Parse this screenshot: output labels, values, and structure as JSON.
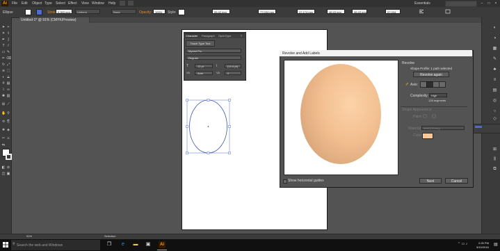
{
  "menubar": {
    "logo": "Ai",
    "items": [
      "File",
      "Edit",
      "Object",
      "Type",
      "Select",
      "Effect",
      "View",
      "Window",
      "Help"
    ],
    "workspace": "Essentials"
  },
  "controlbar": {
    "object_label": "Ellipse",
    "stroke_label": "Stroke:",
    "stroke_value": "0.353 mm",
    "uniform": "Uniform",
    "basic": "Basic",
    "opacity_label": "Opacity:",
    "opacity_value": "100%",
    "style_label": "Style:",
    "x_value": "55.42 mm",
    "y_value": "77.034 mm",
    "w_value": "37.174 mm",
    "h_value": "46.43 mm",
    "w2_value": "96.43 mm",
    "h2_value": "57.034 mm"
  },
  "document": {
    "tab_label": "Untitled-1* @ 91% (CMYK/Preview)",
    "zoom": "91%",
    "tool_status": "Selection"
  },
  "character_panel": {
    "tabs": [
      "Character",
      "Paragraph",
      "OpenType"
    ],
    "touch_type": "Touch Type Tool",
    "font": "Myriad Pro",
    "style": "Regular",
    "size": "12 pt",
    "leading": "(14.4 pt)",
    "kerning": "Auto",
    "tracking": "0"
  },
  "dialog": {
    "title": "Revolve and Add Labels",
    "section_title": "Revolve",
    "profile_status": "Shape Profile: 1 path selected",
    "revolve_again": "Revolve again",
    "axis_label": "Axis:",
    "complexity_label": "Complexity:",
    "complexity_value": "High",
    "segments": "128 segments",
    "appearance_title": "Shape Appearance",
    "paint_label": "Paint:",
    "material_label": "Material:",
    "material_value": "Matt (Glossy)",
    "color_label": "Color:",
    "color_swatch": "#f9c89b",
    "show_guides": "Show horizontal guides",
    "next": "Next",
    "cancel": "Cancel"
  },
  "taskbar": {
    "search_placeholder": "Search the web and Windows",
    "time": "2:26 PM",
    "date": "3/10/2016"
  },
  "colors": {
    "accent": "#ff9a00",
    "egg_light": "#fcd3a8",
    "egg_dark": "#d8a57a",
    "selection": "#4a6cd4"
  }
}
